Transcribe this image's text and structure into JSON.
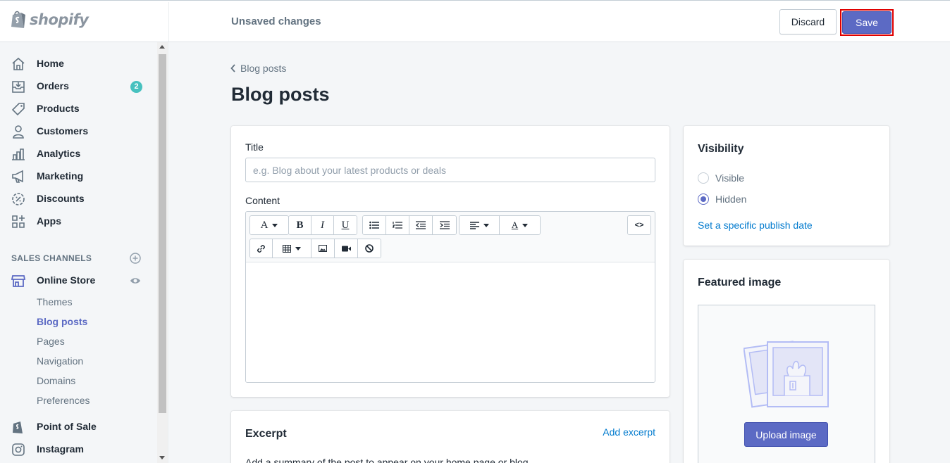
{
  "topbar": {
    "brand": "shopify",
    "status": "Unsaved changes",
    "discard_label": "Discard",
    "save_label": "Save"
  },
  "sidebar": {
    "items": [
      {
        "label": "Home",
        "icon": "home-icon"
      },
      {
        "label": "Orders",
        "icon": "orders-icon",
        "badge": "2"
      },
      {
        "label": "Products",
        "icon": "tag-icon"
      },
      {
        "label": "Customers",
        "icon": "person-icon"
      },
      {
        "label": "Analytics",
        "icon": "bar-chart-icon"
      },
      {
        "label": "Marketing",
        "icon": "megaphone-icon"
      },
      {
        "label": "Discounts",
        "icon": "discount-icon"
      },
      {
        "label": "Apps",
        "icon": "apps-icon"
      }
    ],
    "sales_channels_heading": "SALES CHANNELS",
    "online_store_label": "Online Store",
    "sub_items": [
      "Themes",
      "Blog posts",
      "Pages",
      "Navigation",
      "Domains",
      "Preferences"
    ],
    "active_sub_item": "Blog posts",
    "point_of_sale_label": "Point of Sale",
    "instagram_label": "Instagram"
  },
  "main": {
    "breadcrumb": "Blog posts",
    "page_title": "Blog posts",
    "title_label": "Title",
    "title_placeholder": "e.g. Blog about your latest products or deals",
    "title_value": "",
    "content_label": "Content",
    "toolbar": {
      "font_btn": "A",
      "bold": "B",
      "italic": "I",
      "underline": "U",
      "html_btn": "<>",
      "text_color": "A"
    },
    "excerpt": {
      "title": "Excerpt",
      "add_link": "Add excerpt",
      "description": "Add a summary of the post to appear on your home page or blog."
    }
  },
  "visibility": {
    "title": "Visibility",
    "options": [
      "Visible",
      "Hidden"
    ],
    "selected": "Hidden",
    "publish_date_link": "Set a specific publish date"
  },
  "featured_image": {
    "title": "Featured image",
    "upload_label": "Upload image"
  },
  "colors": {
    "accent": "#5c6ac4",
    "link": "#007ace",
    "badge": "#47c1bf",
    "highlight": "#e00000"
  }
}
